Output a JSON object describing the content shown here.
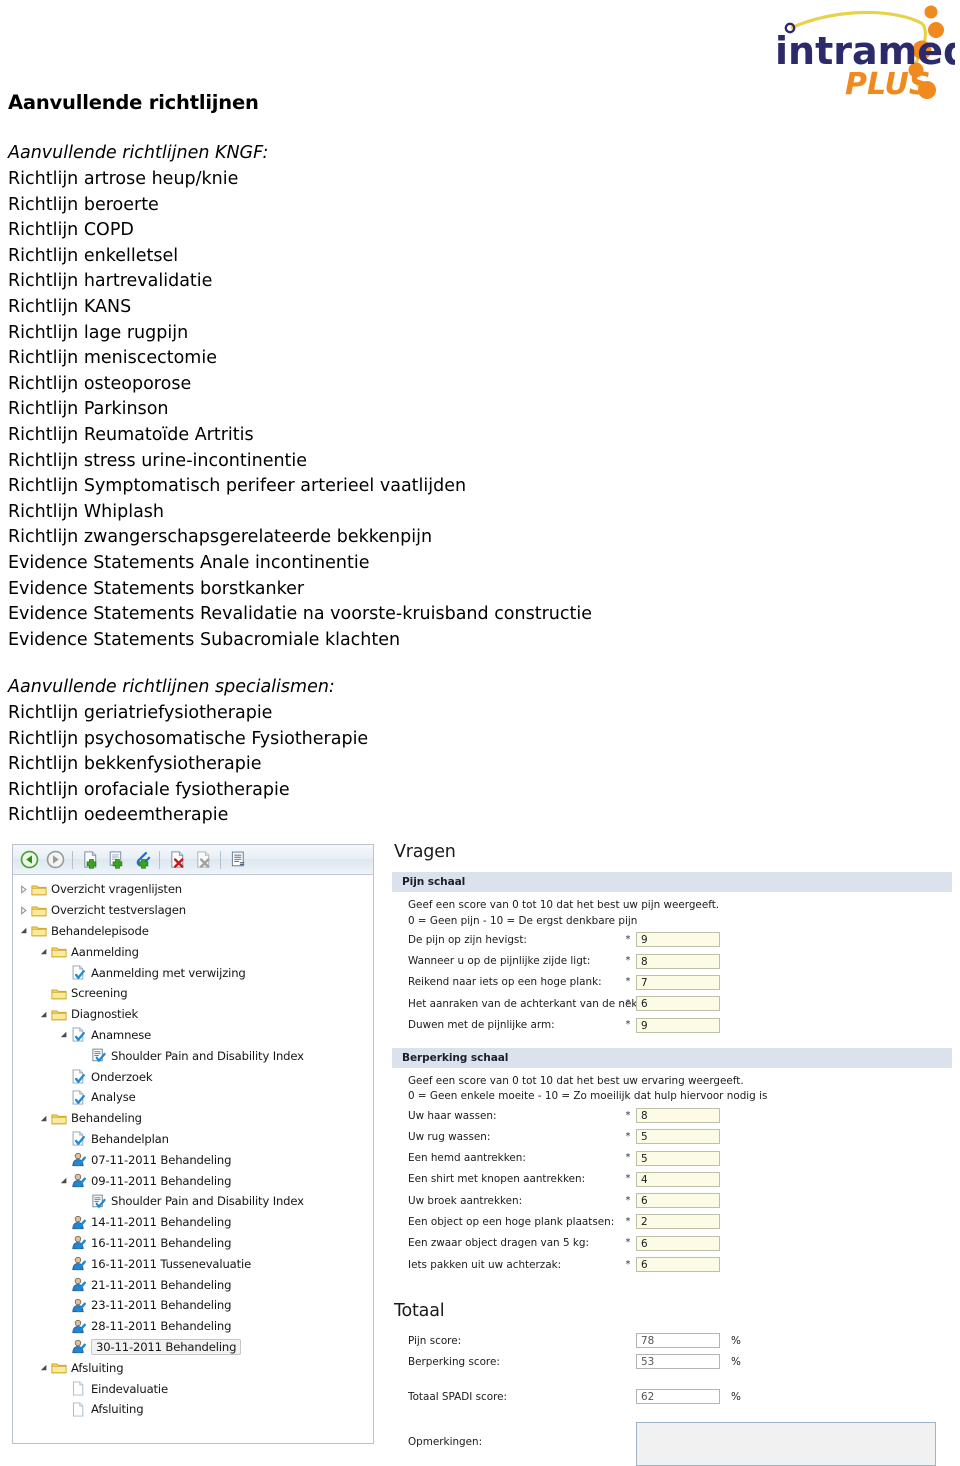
{
  "logo": {
    "brand": "intramed",
    "suffix": "PLUS",
    "brand_color": "#2c2a6b",
    "suffix_color": "#f08a1e",
    "dot_color": "#f08a1e",
    "curve_color": "#e8d24a"
  },
  "document": {
    "title": "Aanvullende richtlijnen",
    "groups": [
      {
        "heading": "Aanvullende richtlijnen KNGF:",
        "items": [
          "Richtlijn artrose heup/knie",
          "Richtlijn beroerte",
          "Richtlijn COPD",
          "Richtlijn enkelletsel",
          "Richtlijn hartrevalidatie",
          "Richtlijn KANS",
          "Richtlijn lage rugpijn",
          "Richtlijn meniscectomie",
          "Richtlijn osteoporose",
          "Richtlijn Parkinson",
          "Richtlijn Reumatoïde Artritis",
          "Richtlijn stress urine-incontinentie",
          "Richtlijn Symptomatisch perifeer arterieel vaatlijden",
          "Richtlijn Whiplash",
          "Richtlijn zwangerschapsgerelateerde bekkenpijn",
          "Evidence Statements Anale incontinentie",
          "Evidence Statements borstkanker",
          "Evidence Statements Revalidatie na voorste-kruisband constructie",
          "Evidence Statements Subacromiale klachten"
        ]
      },
      {
        "heading": "Aanvullende richtlijnen specialismen:",
        "items": [
          "Richtlijn geriatriefysiotherapie",
          "Richtlijn psychosomatische Fysiotherapie",
          "Richtlijn bekkenfysiotherapie",
          "Richtlijn orofaciale fysiotherapie",
          "Richtlijn oedeemtherapie"
        ]
      }
    ]
  },
  "app": {
    "toolbar": [
      {
        "name": "back-icon",
        "label": "Vorige"
      },
      {
        "name": "forward-icon",
        "label": "Volgende"
      },
      {
        "name": "new-document-icon",
        "label": "Nieuw"
      },
      {
        "name": "new-form-icon",
        "label": "Nieuw formulier"
      },
      {
        "name": "new-attachment-icon",
        "label": "Nieuwe bijlage"
      },
      {
        "name": "delete-icon",
        "label": "Verwijderen"
      },
      {
        "name": "delete-disabled-icon",
        "label": "Verwijderen (uit)"
      },
      {
        "name": "edit-properties-icon",
        "label": "Eigenschappen"
      }
    ],
    "tree": [
      {
        "label": "Overzicht vragenlijsten",
        "depth": 0,
        "icon": "folder-icon",
        "twist": "collapsed",
        "selected": false
      },
      {
        "label": "Overzicht testverslagen",
        "depth": 0,
        "icon": "folder-icon",
        "twist": "collapsed",
        "selected": false
      },
      {
        "label": "Behandelepisode",
        "depth": 0,
        "icon": "folder-icon",
        "twist": "expanded",
        "selected": false
      },
      {
        "label": "Aanmelding",
        "depth": 1,
        "icon": "folder-icon",
        "twist": "expanded",
        "selected": false
      },
      {
        "label": "Aanmelding met verwijzing",
        "depth": 2,
        "icon": "doc-check-icon",
        "twist": "none",
        "selected": false
      },
      {
        "label": "Screening",
        "depth": 1,
        "icon": "folder-icon",
        "twist": "none",
        "selected": false
      },
      {
        "label": "Diagnostiek",
        "depth": 1,
        "icon": "folder-icon",
        "twist": "expanded",
        "selected": false
      },
      {
        "label": "Anamnese",
        "depth": 2,
        "icon": "doc-check-icon",
        "twist": "expanded",
        "selected": false
      },
      {
        "label": "Shoulder Pain and Disability Index",
        "depth": 3,
        "icon": "form-check-icon",
        "twist": "none",
        "selected": false
      },
      {
        "label": "Onderzoek",
        "depth": 2,
        "icon": "doc-check-icon",
        "twist": "none",
        "selected": false
      },
      {
        "label": "Analyse",
        "depth": 2,
        "icon": "doc-check-icon",
        "twist": "none",
        "selected": false
      },
      {
        "label": "Behandeling",
        "depth": 1,
        "icon": "folder-icon",
        "twist": "expanded",
        "selected": false
      },
      {
        "label": "Behandelplan",
        "depth": 2,
        "icon": "doc-check-icon",
        "twist": "none",
        "selected": false
      },
      {
        "label": "07-11-2011 Behandeling",
        "depth": 2,
        "icon": "person-check-icon",
        "twist": "none",
        "selected": false
      },
      {
        "label": "09-11-2011 Behandeling",
        "depth": 2,
        "icon": "person-check-icon",
        "twist": "expanded",
        "selected": false
      },
      {
        "label": "Shoulder Pain and Disability Index",
        "depth": 3,
        "icon": "form-check-icon",
        "twist": "none",
        "selected": false
      },
      {
        "label": "14-11-2011 Behandeling",
        "depth": 2,
        "icon": "person-check-icon",
        "twist": "none",
        "selected": false
      },
      {
        "label": "16-11-2011 Behandeling",
        "depth": 2,
        "icon": "person-check-icon",
        "twist": "none",
        "selected": false
      },
      {
        "label": "16-11-2011 Tussenevaluatie",
        "depth": 2,
        "icon": "person-check-icon",
        "twist": "none",
        "selected": false
      },
      {
        "label": "21-11-2011 Behandeling",
        "depth": 2,
        "icon": "person-check-icon",
        "twist": "none",
        "selected": false
      },
      {
        "label": "23-11-2011 Behandeling",
        "depth": 2,
        "icon": "person-check-icon",
        "twist": "none",
        "selected": false
      },
      {
        "label": "28-11-2011 Behandeling",
        "depth": 2,
        "icon": "person-check-icon",
        "twist": "none",
        "selected": false
      },
      {
        "label": "30-11-2011 Behandeling",
        "depth": 2,
        "icon": "person-check-icon",
        "twist": "none",
        "selected": true
      },
      {
        "label": "Afsluiting",
        "depth": 1,
        "icon": "folder-icon",
        "twist": "expanded",
        "selected": false
      },
      {
        "label": "Eindevaluatie",
        "depth": 2,
        "icon": "doc-blank-icon",
        "twist": "none",
        "selected": false
      },
      {
        "label": "Afsluiting",
        "depth": 2,
        "icon": "doc-blank-icon",
        "twist": "none",
        "selected": false
      }
    ],
    "form": {
      "header": "Vragen",
      "sections": [
        {
          "title": "Pijn schaal",
          "instructions": [
            "Geef een score van 0 tot 10 dat het best uw pijn weergeeft.",
            "0 = Geen pijn - 10 = De ergst denkbare pijn"
          ],
          "questions": [
            {
              "label": "De pijn op zijn hevigst:",
              "required": "*",
              "value": "9"
            },
            {
              "label": "Wanneer u op de pijnlijke zijde ligt:",
              "required": "*",
              "value": "8"
            },
            {
              "label": "Reikend naar iets op een hoge plank:",
              "required": "*",
              "value": "7"
            },
            {
              "label": "Het aanraken van de achterkant van de nek:",
              "required": "*",
              "value": "6"
            },
            {
              "label": "Duwen met de pijnlijke arm:",
              "required": "*",
              "value": "9"
            }
          ]
        },
        {
          "title": "Berperking schaal",
          "instructions": [
            "Geef een score van 0 tot 10 dat het best uw ervaring weergeeft.",
            "0 = Geen enkele moeite - 10 = Zo moeilijk dat hulp hiervoor nodig is"
          ],
          "questions": [
            {
              "label": "Uw haar wassen:",
              "required": "*",
              "value": "8"
            },
            {
              "label": "Uw rug wassen:",
              "required": "*",
              "value": "5"
            },
            {
              "label": "Een hemd aantrekken:",
              "required": "*",
              "value": "5"
            },
            {
              "label": "Een shirt met knopen aantrekken:",
              "required": "*",
              "value": "4"
            },
            {
              "label": "Uw broek aantrekken:",
              "required": "*",
              "value": "6"
            },
            {
              "label": "Een object op een hoge plank plaatsen:",
              "required": "*",
              "value": "2"
            },
            {
              "label": "Een zwaar object dragen van 5 kg:",
              "required": "*",
              "value": "6"
            },
            {
              "label": "Iets pakken uit uw achterzak:",
              "required": "*",
              "value": "6"
            }
          ]
        }
      ],
      "total": {
        "header": "Totaal",
        "rows": [
          {
            "label": "Pijn score:",
            "value": "78",
            "unit": "%"
          },
          {
            "label": "Berperking score:",
            "value": "53",
            "unit": "%"
          },
          {
            "label": "Totaal SPADI score:",
            "value": "62",
            "unit": "%"
          }
        ],
        "notes_label": "Opmerkingen:",
        "notes_value": ""
      }
    }
  }
}
